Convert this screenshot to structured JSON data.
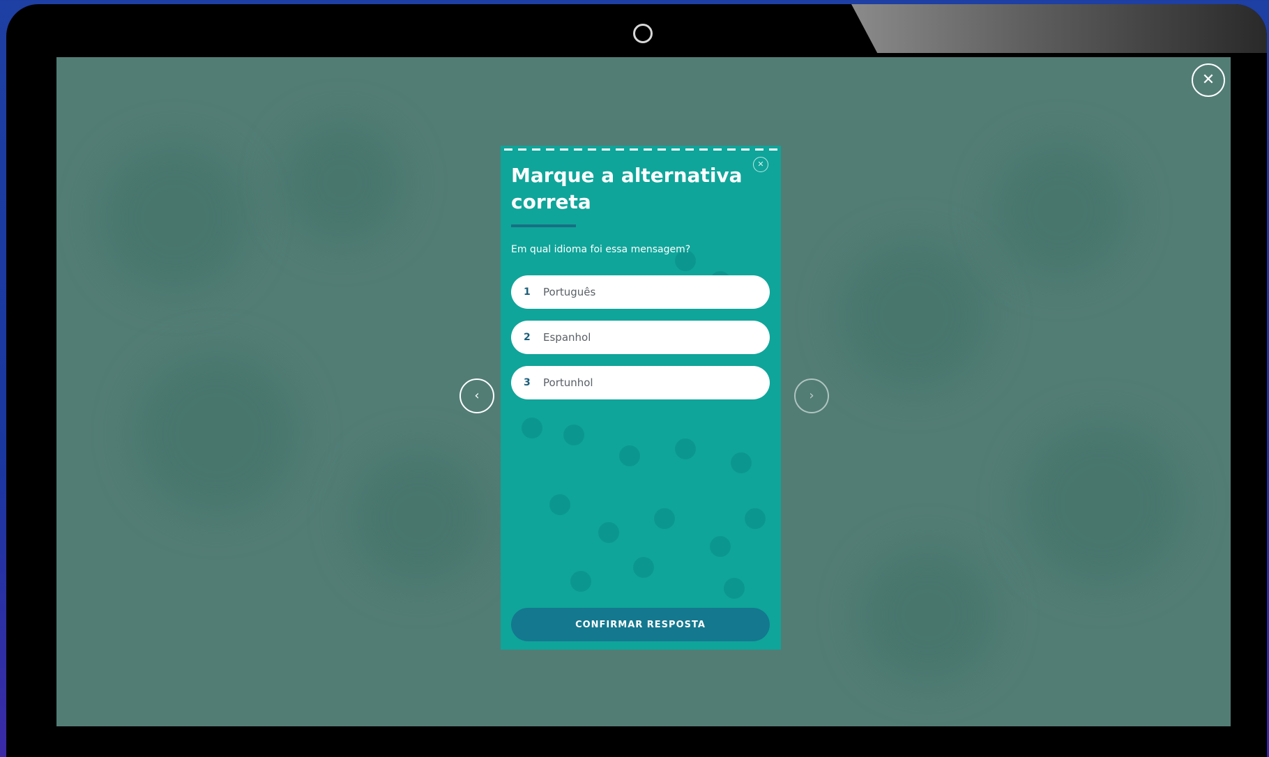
{
  "lesson_viewer": {
    "close_icon_glyph": "✕",
    "prev_icon_glyph": "‹",
    "next_icon_glyph": "›"
  },
  "quiz": {
    "title": "Marque a alternativa correta",
    "question": "Em qual idioma foi essa mensagem?",
    "close_icon_glyph": "✕",
    "options": [
      {
        "number": "1",
        "label": "Português"
      },
      {
        "number": "2",
        "label": "Espanhol"
      },
      {
        "number": "3",
        "label": "Portunhol"
      }
    ],
    "confirm_label": "CONFIRMAR RESPOSTA"
  },
  "colors": {
    "screen_background": "#527d75",
    "card_background": "#0fa59a",
    "accent": "#14788f"
  }
}
